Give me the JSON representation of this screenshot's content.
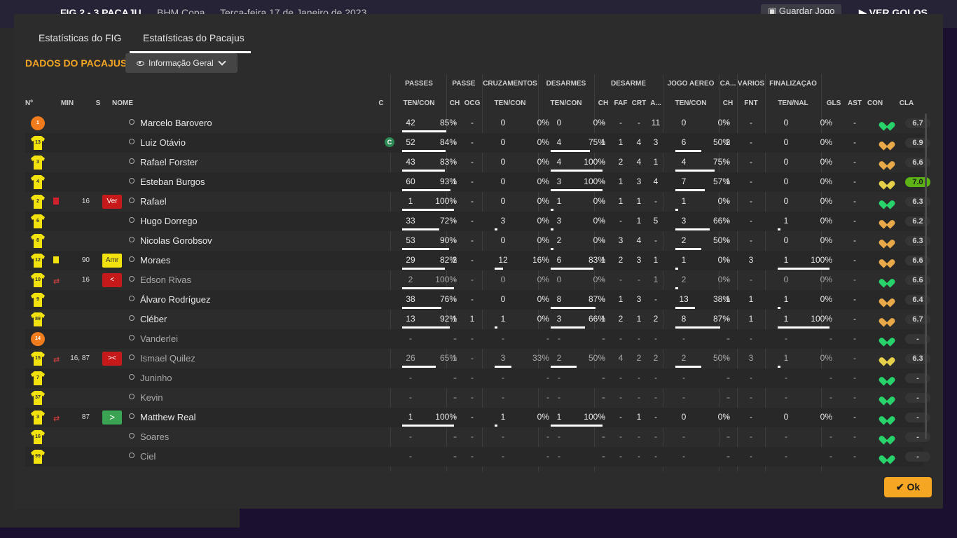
{
  "background": {
    "match": "FIG  2 - 3  PACAJU",
    "competition": "BHM Copa",
    "date": "Terça-feira 17 de Janeiro de 2023",
    "save_label": "Guardar Jogo",
    "goals_label": "VER GOLOS"
  },
  "tabs": [
    "Estatísticas do FIG",
    "Estatísticas do Pacajus"
  ],
  "team_title": "DADOS DO PACAJUS",
  "view_select": "Informação Geral",
  "groups": [
    "PASSES",
    "PASSE",
    "CRUZAMENTOS",
    "DESARMES",
    "DESARME",
    "JOGO AÉREO",
    "CA...",
    "VÁRIOS",
    "FINALIZAÇÃO"
  ],
  "columns": [
    "Nº",
    "MIN",
    "S",
    "NOME",
    "C",
    "TEN/CON",
    "CH",
    "OCG",
    "TEN/CON",
    "TEN/CON",
    "CH",
    "FAF",
    "CRT",
    "A...",
    "TEN/CON",
    "CH",
    "FNT",
    "TEN/NAL",
    "GLS",
    "AST",
    "CON",
    "CLA"
  ],
  "players": [
    {
      "n": "1",
      "name": "Marcelo Barovero",
      "gk": true,
      "pas": [
        "42",
        "85%"
      ],
      "pch": "-",
      "ocg": "-",
      "cru": [
        "0",
        "0%"
      ],
      "des": [
        "0",
        "0%"
      ],
      "dch": "-",
      "faf": "-",
      "crt": "-",
      "a": "11",
      "aer": [
        "0",
        "0%"
      ],
      "cach": "-",
      "fnt": "-",
      "fin": [
        "0",
        "0%"
      ],
      "gls": "",
      "ast": "-",
      "con": "green",
      "cla": "6.7"
    },
    {
      "n": "13",
      "name": "Luiz Otávio",
      "cap": "C",
      "pas": [
        "52",
        "84%"
      ],
      "pch": "-",
      "ocg": "-",
      "cru": [
        "0",
        "0%"
      ],
      "des": [
        "4",
        "75%"
      ],
      "dch": "1",
      "faf": "1",
      "crt": "4",
      "a": "3",
      "aer": [
        "6",
        "50%"
      ],
      "cach": "2",
      "fnt": "-",
      "fin": [
        "0",
        "0%"
      ],
      "gls": "",
      "ast": "-",
      "con": "orange",
      "cla": "6.9"
    },
    {
      "n": "3",
      "name": "Rafael Forster",
      "pas": [
        "43",
        "83%"
      ],
      "pch": "-",
      "ocg": "-",
      "cru": [
        "0",
        "0%"
      ],
      "des": [
        "4",
        "100%"
      ],
      "dch": "-",
      "faf": "2",
      "crt": "4",
      "a": "1",
      "aer": [
        "4",
        "75%"
      ],
      "cach": "-",
      "fnt": "-",
      "fin": [
        "0",
        "0%"
      ],
      "gls": "",
      "ast": "-",
      "con": "orange",
      "cla": "6.6"
    },
    {
      "n": "4",
      "name": "Esteban Burgos",
      "pas": [
        "60",
        "93%"
      ],
      "pch": "1",
      "ocg": "-",
      "cru": [
        "0",
        "0%"
      ],
      "des": [
        "3",
        "100%"
      ],
      "dch": "-",
      "faf": "1",
      "crt": "3",
      "a": "4",
      "aer": [
        "7",
        "57%"
      ],
      "cach": "1",
      "fnt": "-",
      "fin": [
        "0",
        "0%"
      ],
      "gls": "",
      "ast": "-",
      "con": "yellow",
      "cla": "7.0",
      "top": true
    },
    {
      "n": "2",
      "name": "Rafael",
      "card": "red",
      "min": "16",
      "badge": "Ver",
      "badgeType": "red",
      "pas": [
        "1",
        "100%"
      ],
      "pch": "-",
      "ocg": "-",
      "cru": [
        "0",
        "0%"
      ],
      "des": [
        "1",
        "0%"
      ],
      "dch": "-",
      "faf": "1",
      "crt": "1",
      "a": "-",
      "aer": [
        "1",
        "0%"
      ],
      "cach": "-",
      "fnt": "-",
      "fin": [
        "0",
        "0%"
      ],
      "gls": "",
      "ast": "-",
      "con": "green",
      "cla": "6.3"
    },
    {
      "n": "6",
      "name": "Hugo Dorrego",
      "pas": [
        "33",
        "72%"
      ],
      "pch": "-",
      "ocg": "-",
      "cru": [
        "3",
        "0%"
      ],
      "des": [
        "3",
        "0%"
      ],
      "dch": "-",
      "faf": "-",
      "crt": "1",
      "a": "5",
      "aer": [
        "3",
        "66%"
      ],
      "cach": "-",
      "fnt": "-",
      "fin": [
        "1",
        "0%"
      ],
      "gls": "",
      "ast": "-",
      "con": "orange",
      "cla": "6.2"
    },
    {
      "n": "8",
      "name": "Nicolas Gorobsov",
      "pas": [
        "53",
        "90%"
      ],
      "pch": "-",
      "ocg": "-",
      "cru": [
        "0",
        "0%"
      ],
      "des": [
        "2",
        "0%"
      ],
      "dch": "-",
      "faf": "3",
      "crt": "4",
      "a": "-",
      "aer": [
        "2",
        "50%"
      ],
      "cach": "-",
      "fnt": "-",
      "fin": [
        "0",
        "0%"
      ],
      "gls": "",
      "ast": "-",
      "con": "orange",
      "cla": "6.3"
    },
    {
      "n": "12",
      "name": "Moraes",
      "card": "yellow",
      "min": "90",
      "badge": "Amr",
      "badgeType": "yel",
      "pas": [
        "29",
        "82%"
      ],
      "pch": "2",
      "ocg": "-",
      "cru": [
        "12",
        "16%"
      ],
      "des": [
        "6",
        "83%"
      ],
      "dch": "1",
      "faf": "2",
      "crt": "3",
      "a": "1",
      "aer": [
        "1",
        "0%"
      ],
      "cach": "-",
      "fnt": "3",
      "fin": [
        "1",
        "100%"
      ],
      "gls": "",
      "ast": "-",
      "con": "orange",
      "cla": "6.6"
    },
    {
      "n": "10",
      "name": "Edson Rivas",
      "sub": true,
      "arrows": "⇄",
      "min": "16",
      "badge": "<",
      "badgeType": "red",
      "pas": [
        "2",
        "100%"
      ],
      "pch": "-",
      "ocg": "-",
      "cru": [
        "0",
        "0%"
      ],
      "des": [
        "0",
        "0%"
      ],
      "dch": "-",
      "faf": "-",
      "crt": "-",
      "a": "1",
      "aer": [
        "2",
        "0%"
      ],
      "cach": "-",
      "fnt": "-",
      "fin": [
        "0",
        "0%"
      ],
      "gls": "",
      "ast": "-",
      "con": "green",
      "cla": "6.6"
    },
    {
      "n": "9",
      "name": "Álvaro Rodríguez",
      "pas": [
        "38",
        "76%"
      ],
      "pch": "-",
      "ocg": "-",
      "cru": [
        "0",
        "0%"
      ],
      "des": [
        "8",
        "87%"
      ],
      "dch": "-",
      "faf": "1",
      "crt": "3",
      "a": "-",
      "aer": [
        "13",
        "38%"
      ],
      "cach": "1",
      "fnt": "1",
      "fin": [
        "1",
        "0%"
      ],
      "gls": "",
      "ast": "-",
      "con": "orange",
      "cla": "6.4"
    },
    {
      "n": "89",
      "name": "Cléber",
      "pas": [
        "13",
        "92%"
      ],
      "pch": "1",
      "ocg": "1",
      "cru": [
        "1",
        "0%"
      ],
      "des": [
        "3",
        "66%"
      ],
      "dch": "1",
      "faf": "2",
      "crt": "1",
      "a": "2",
      "aer": [
        "8",
        "87%"
      ],
      "cach": "-",
      "fnt": "1",
      "fin": [
        "1",
        "100%"
      ],
      "gls": "",
      "ast": "-",
      "con": "orange",
      "cla": "6.7"
    },
    {
      "n": "14",
      "name": "Vanderlei",
      "gk": true,
      "sub": true,
      "pas": [
        "-",
        "-"
      ],
      "pch": "-",
      "ocg": "-",
      "cru": [
        "-",
        "-"
      ],
      "des": [
        "-",
        "-"
      ],
      "dch": "-",
      "faf": "-",
      "crt": "-",
      "a": "-",
      "aer": [
        "-",
        "-"
      ],
      "cach": "-",
      "fnt": "-",
      "fin": [
        "-",
        "-"
      ],
      "gls": "",
      "ast": "-",
      "con": "green",
      "cla": "-"
    },
    {
      "n": "15",
      "name": "Ismael Quilez",
      "sub": true,
      "arrows": "⇄",
      "min": "16, 87",
      "badge": "><",
      "badgeType": "red",
      "pas": [
        "26",
        "65%"
      ],
      "pch": "1",
      "ocg": "-",
      "cru": [
        "3",
        "33%"
      ],
      "des": [
        "2",
        "50%"
      ],
      "dch": "-",
      "faf": "4",
      "crt": "2",
      "a": "2",
      "aer": [
        "2",
        "50%"
      ],
      "cach": "-",
      "fnt": "3",
      "fin": [
        "1",
        "0%"
      ],
      "gls": "",
      "ast": "-",
      "con": "yellow",
      "cla": "6.3"
    },
    {
      "n": "7",
      "name": "Juninho",
      "sub": true,
      "pas": [
        "-",
        "-"
      ],
      "pch": "-",
      "ocg": "-",
      "cru": [
        "-",
        "-"
      ],
      "des": [
        "-",
        "-"
      ],
      "dch": "-",
      "faf": "-",
      "crt": "-",
      "a": "-",
      "aer": [
        "-",
        "-"
      ],
      "cach": "-",
      "fnt": "-",
      "fin": [
        "-",
        "-"
      ],
      "gls": "",
      "ast": "-",
      "con": "green",
      "cla": "-"
    },
    {
      "n": "37",
      "name": "Kevin",
      "sub": true,
      "pas": [
        "-",
        "-"
      ],
      "pch": "-",
      "ocg": "-",
      "cru": [
        "-",
        "-"
      ],
      "des": [
        "-",
        "-"
      ],
      "dch": "-",
      "faf": "-",
      "crt": "-",
      "a": "-",
      "aer": [
        "-",
        "-"
      ],
      "cach": "-",
      "fnt": "-",
      "fin": [
        "-",
        "-"
      ],
      "gls": "",
      "ast": "-",
      "con": "green",
      "cla": "-"
    },
    {
      "n": "3",
      "name": "Matthew Real",
      "arrows": "⇄",
      "min": "87",
      "badge": ">",
      "badgeType": "green",
      "pas": [
        "1",
        "100%"
      ],
      "pch": "-",
      "ocg": "-",
      "cru": [
        "1",
        "0%"
      ],
      "des": [
        "1",
        "100%"
      ],
      "dch": "-",
      "faf": "-",
      "crt": "1",
      "a": "-",
      "aer": [
        "0",
        "0%"
      ],
      "cach": "-",
      "fnt": "-",
      "fin": [
        "0",
        "0%"
      ],
      "gls": "",
      "ast": "-",
      "con": "green",
      "cla": "-"
    },
    {
      "n": "16",
      "name": "Soares",
      "sub": true,
      "pas": [
        "-",
        "-"
      ],
      "pch": "-",
      "ocg": "-",
      "cru": [
        "-",
        "-"
      ],
      "des": [
        "-",
        "-"
      ],
      "dch": "-",
      "faf": "-",
      "crt": "-",
      "a": "-",
      "aer": [
        "-",
        "-"
      ],
      "cach": "-",
      "fnt": "-",
      "fin": [
        "-",
        "-"
      ],
      "gls": "",
      "ast": "-",
      "con": "green",
      "cla": "-"
    },
    {
      "n": "99",
      "name": "Ciel",
      "sub": true,
      "pas": [
        "-",
        "-"
      ],
      "pch": "-",
      "ocg": "-",
      "cru": [
        "-",
        "-"
      ],
      "des": [
        "-",
        "-"
      ],
      "dch": "-",
      "faf": "-",
      "crt": "-",
      "a": "-",
      "aer": [
        "-",
        "-"
      ],
      "cach": "-",
      "fnt": "-",
      "fin": [
        "-",
        "-"
      ],
      "gls": "",
      "ast": "-",
      "con": "green",
      "cla": "-"
    }
  ],
  "ok_label": "Ok",
  "colors": {
    "accent": "#f5a623",
    "shirt": "#f2e20e",
    "gk": "#f07c1d",
    "top_rating": "#5bb315"
  }
}
